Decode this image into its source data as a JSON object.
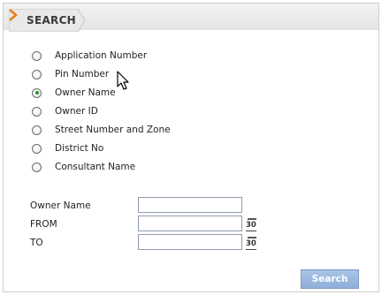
{
  "panel": {
    "tab_title": "SEARCH"
  },
  "search_by": {
    "options": [
      {
        "label": "Application Number",
        "checked": false
      },
      {
        "label": "Pin Number",
        "checked": false
      },
      {
        "label": "Owner Name",
        "checked": true
      },
      {
        "label": "Owner ID",
        "checked": false
      },
      {
        "label": "Street Number and Zone",
        "checked": false
      },
      {
        "label": "District No",
        "checked": false
      },
      {
        "label": "Consultant Name",
        "checked": false
      }
    ]
  },
  "form": {
    "owner_name_label": "Owner Name",
    "owner_name_value": "",
    "from_label": "FROM",
    "from_value": "",
    "to_label": "TO",
    "to_value": "",
    "calendar_day": "30"
  },
  "actions": {
    "search_label": "Search"
  },
  "colors": {
    "button": "#9ab8e0",
    "selected_radio": "#2d8c2d",
    "tab_arrow": "#e8801e"
  }
}
